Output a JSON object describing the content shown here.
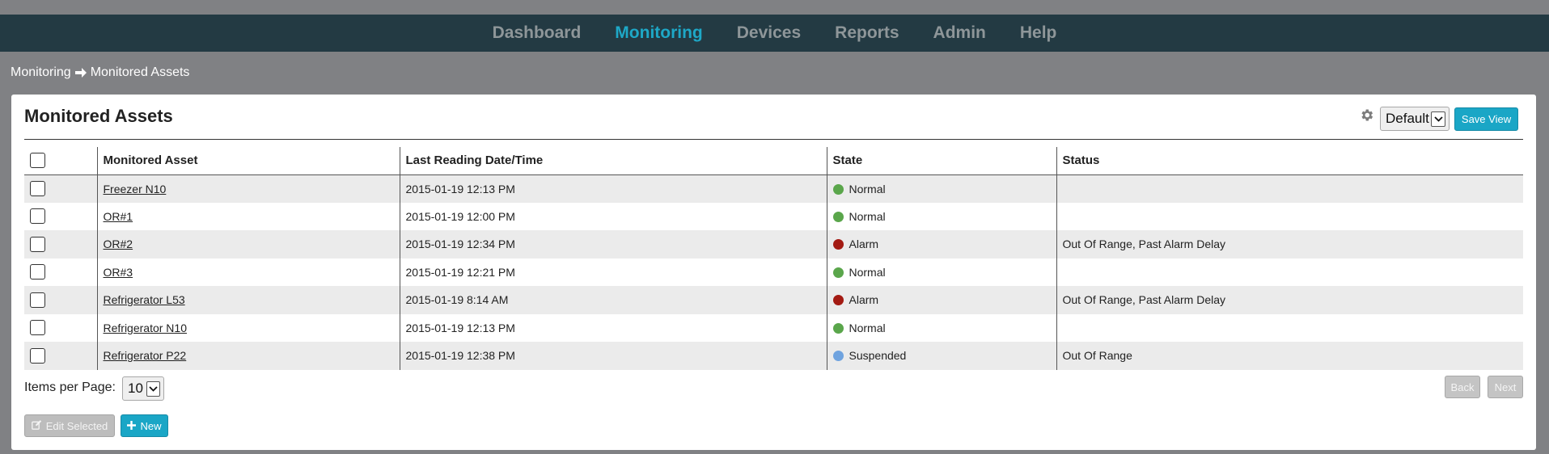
{
  "nav": {
    "items": [
      {
        "label": "Dashboard",
        "active": false
      },
      {
        "label": "Monitoring",
        "active": true
      },
      {
        "label": "Devices",
        "active": false
      },
      {
        "label": "Reports",
        "active": false
      },
      {
        "label": "Admin",
        "active": false
      },
      {
        "label": "Help",
        "active": false
      }
    ],
    "active_color": "#1ea8c7"
  },
  "breadcrumb": {
    "parent": "Monitoring",
    "current": "Monitored Assets",
    "separator_icon": "arrow-right-icon"
  },
  "panel": {
    "title": "Monitored Assets",
    "settings_icon": "gear-icon",
    "view_select": {
      "selected": "Default"
    },
    "save_view_label": "Save View"
  },
  "table": {
    "columns": [
      "",
      "Monitored Asset",
      "Last Reading Date/Time",
      "State",
      "Status"
    ],
    "rows": [
      {
        "asset": "Freezer N10",
        "datetime": "2015-01-19 12:13 PM",
        "state": "Normal",
        "state_color": "#5aa64b",
        "status": ""
      },
      {
        "asset": "OR#1",
        "datetime": "2015-01-19 12:00 PM",
        "state": "Normal",
        "state_color": "#5aa64b",
        "status": ""
      },
      {
        "asset": "OR#2",
        "datetime": "2015-01-19 12:34 PM",
        "state": "Alarm",
        "state_color": "#a31a12",
        "status": "Out Of Range, Past Alarm Delay"
      },
      {
        "asset": "OR#3",
        "datetime": "2015-01-19 12:21 PM",
        "state": "Normal",
        "state_color": "#5aa64b",
        "status": ""
      },
      {
        "asset": "Refrigerator L53",
        "datetime": "2015-01-19 8:14 AM",
        "state": "Alarm",
        "state_color": "#a31a12",
        "status": "Out Of Range, Past Alarm Delay"
      },
      {
        "asset": "Refrigerator N10",
        "datetime": "2015-01-19 12:13 PM",
        "state": "Normal",
        "state_color": "#5aa64b",
        "status": ""
      },
      {
        "asset": "Refrigerator P22",
        "datetime": "2015-01-19 12:38 PM",
        "state": "Suspended",
        "state_color": "#6fa3df",
        "status": "Out Of Range"
      }
    ]
  },
  "footer": {
    "items_per_page_label": "Items per Page:",
    "items_per_page_value": "10",
    "back_label": "Back",
    "next_label": "Next",
    "edit_selected_label": "Edit Selected",
    "new_label": "New"
  },
  "colors": {
    "nav_bg": "#233a43",
    "accent": "#1aa6c6",
    "page_bg": "#808184"
  }
}
